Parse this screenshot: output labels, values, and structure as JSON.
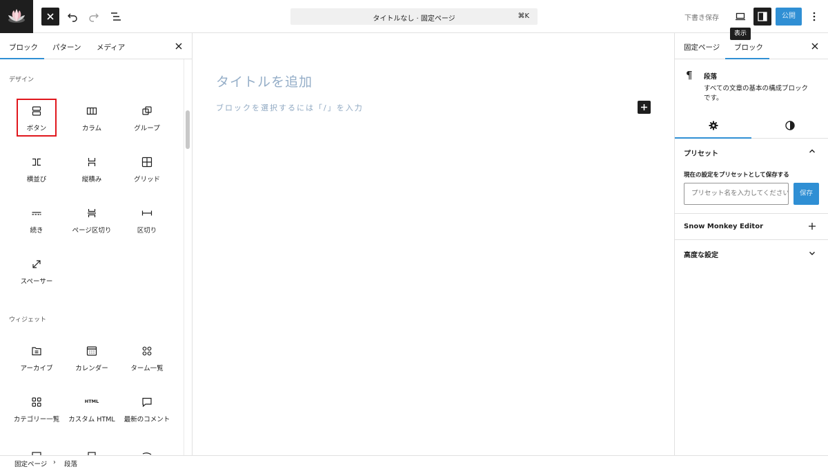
{
  "header": {
    "doc_title": "タイトルなし · 固定ページ",
    "shortcut": "⌘K",
    "draft_label": "下書き保存",
    "publish_label": "公開",
    "tooltip": "表示"
  },
  "inserter": {
    "tabs": [
      {
        "label": "ブロック",
        "active": true
      },
      {
        "label": "パターン",
        "active": false
      },
      {
        "label": "メディア",
        "active": false
      }
    ],
    "sections": [
      {
        "label": "デザイン",
        "items": [
          {
            "label": "ボタン",
            "icon": "buttons-icon"
          },
          {
            "label": "カラム",
            "icon": "columns-icon"
          },
          {
            "label": "グループ",
            "icon": "group-icon"
          },
          {
            "label": "横並び",
            "icon": "row-icon"
          },
          {
            "label": "縦積み",
            "icon": "stack-icon"
          },
          {
            "label": "グリッド",
            "icon": "grid-icon"
          },
          {
            "label": "続き",
            "icon": "more-icon"
          },
          {
            "label": "ページ区切り",
            "icon": "page-break-icon"
          },
          {
            "label": "区切り",
            "icon": "separator-icon"
          },
          {
            "label": "スペーサー",
            "icon": "spacer-icon"
          }
        ]
      },
      {
        "label": "ウィジェット",
        "items": [
          {
            "label": "アーカイブ",
            "icon": "archive-icon"
          },
          {
            "label": "カレンダー",
            "icon": "calendar-icon"
          },
          {
            "label": "ターム一覧",
            "icon": "term-list-icon"
          },
          {
            "label": "カテゴリー一覧",
            "icon": "category-list-icon"
          },
          {
            "label": "カスタム HTML",
            "icon": "html-icon",
            "icon_text": "HTML"
          },
          {
            "label": "最新のコメント",
            "icon": "comment-icon"
          }
        ]
      }
    ]
  },
  "canvas": {
    "title_placeholder": "タイトルを追加",
    "paragraph_placeholder": "ブロックを選択するには「/」を入力"
  },
  "sidebar": {
    "tabs": [
      {
        "label": "固定ページ",
        "active": false
      },
      {
        "label": "ブロック",
        "active": true
      }
    ],
    "block": {
      "icon": "¶",
      "name": "段落",
      "description": "すべての文章の基本の構成ブロックです。"
    },
    "presets": {
      "title": "プリセット",
      "save_label": "現在の設定をプリセットとして保存する",
      "input_placeholder": "プリセット名を入力してください",
      "save_button": "保存"
    },
    "panels": [
      {
        "title": "Snow Monkey Editor",
        "icon": "plus-icon"
      },
      {
        "title": "高度な設定",
        "icon": "chevron-down-icon"
      }
    ]
  },
  "breadcrumb": [
    "固定ページ",
    "段落"
  ],
  "colors": {
    "accent": "#2f8fd4",
    "dark": "#1e1e1e",
    "highlight": "#e0161c"
  }
}
